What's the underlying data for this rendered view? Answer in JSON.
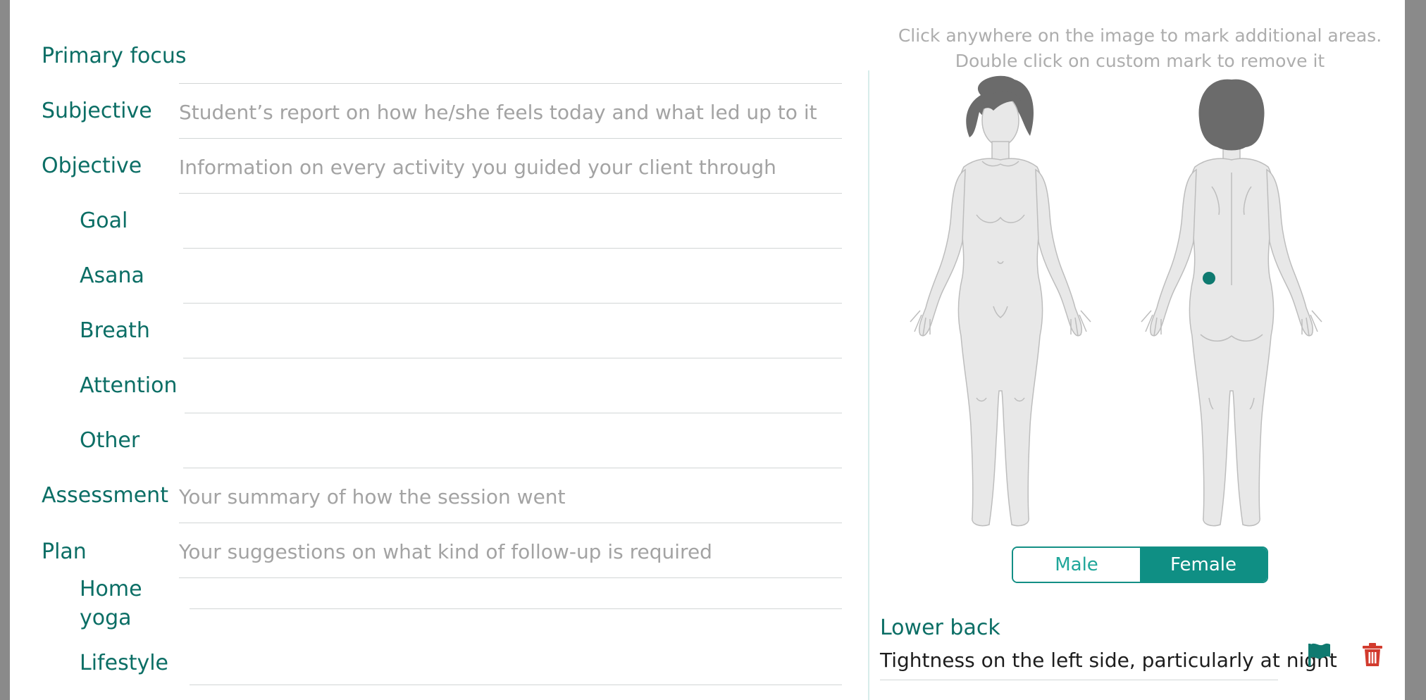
{
  "form": {
    "primary_focus": {
      "label": "Primary focus",
      "value": ""
    },
    "subjective": {
      "label": "Subjective",
      "placeholder": "Student’s report on how he/she feels today and what led up to it"
    },
    "objective": {
      "label": "Objective",
      "placeholder": "Information on every activity you guided your client through"
    },
    "goal": {
      "label": "Goal",
      "value": ""
    },
    "asana": {
      "label": "Asana",
      "value": ""
    },
    "breath": {
      "label": "Breath",
      "value": ""
    },
    "attention": {
      "label": "Attention",
      "value": ""
    },
    "other": {
      "label": "Other",
      "value": ""
    },
    "assessment": {
      "label": "Assessment",
      "placeholder": "Your summary of how the session went"
    },
    "plan": {
      "label": "Plan",
      "placeholder": "Your suggestions on what kind of follow-up is required"
    },
    "home_yoga": {
      "label_line1": "Home",
      "label_line2": "yoga",
      "value": ""
    },
    "lifestyle": {
      "label": "Lifestyle",
      "value": ""
    }
  },
  "body_map": {
    "hint_line1": "Click anywhere on the image to mark additional areas.",
    "hint_line2": "Double click on custom mark to remove it",
    "toggle": {
      "male": "Male",
      "female": "Female",
      "selected": "Female"
    },
    "marker_color": "#0f7a70",
    "figure_fill": "#e8e8e8",
    "hair_color": "#6b6b6b"
  },
  "marked_area": {
    "title": "Lower back",
    "note": "Tightness on the left side, particularly at night",
    "flag_icon": "flag-icon",
    "delete_icon": "trash-icon",
    "flag_color": "#0f7a70",
    "delete_color": "#d23b2e"
  },
  "colors": {
    "label": "#0b6e65",
    "accent": "#0f8f84"
  }
}
